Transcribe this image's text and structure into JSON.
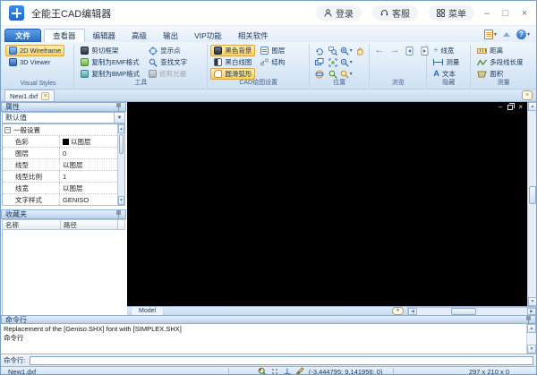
{
  "window": {
    "title": "全能王CAD编辑器",
    "minimize": "–",
    "maximize": "□",
    "close": "×"
  },
  "titlebar": {
    "login": "登录",
    "service": "客服",
    "menu": "菜单"
  },
  "tabs": [
    {
      "label": "文件"
    },
    {
      "label": "查看器"
    },
    {
      "label": "编辑器"
    },
    {
      "label": "高级"
    },
    {
      "label": "输出"
    },
    {
      "label": "VIP功能"
    },
    {
      "label": "相关软件"
    }
  ],
  "ribbon": {
    "visual_styles": {
      "label": "Visual Styles",
      "wireframe": "2D Wireframe",
      "viewer": "3D Viewer"
    },
    "tools": {
      "label": "工具",
      "cut_frame": "剪切框架",
      "copy_emf": "复制为EMF格式",
      "copy_bmp": "复制为BMP格式",
      "show_points": "显示点",
      "find_text": "查找文字",
      "trim_raster": "修剪光栅"
    },
    "cad_settings": {
      "label": "CAD绘图设置",
      "black_bg": "黑色背景",
      "layers": "图层",
      "bw_drawing": "黑白线图",
      "structure": "结构",
      "smooth_arc": "圆滑弧形"
    },
    "position": {
      "label": "位置"
    },
    "browse": {
      "label": "浏览"
    },
    "hide": {
      "label": "隐藏",
      "line_width": "线宽",
      "measure": "测量",
      "text": "文本"
    },
    "measure": {
      "label": "测量",
      "distance": "距离",
      "polyline_length": "多段线长度",
      "area": "面积"
    }
  },
  "document": {
    "tab": "New1.dxf",
    "model_tab": "Model"
  },
  "properties": {
    "title": "属性",
    "preset": "默认值",
    "group": "一般设置",
    "rows": [
      {
        "name": "色彩",
        "value": "以图层"
      },
      {
        "name": "图层",
        "value": "0"
      },
      {
        "name": "线型",
        "value": "以图层"
      },
      {
        "name": "线型比例",
        "value": "1"
      },
      {
        "name": "线宽",
        "value": "以图层"
      },
      {
        "name": "文字样式",
        "value": "GENISO"
      }
    ]
  },
  "favorites": {
    "title": "收藏夹",
    "col_name": "名称",
    "col_path": "路径"
  },
  "command": {
    "title": "命令行",
    "line1": "Replacement of the [Geniso.SHX] font with [SIMPLEX.SHX]",
    "line2": "命令行",
    "prompt": "命令行:",
    "input_value": ""
  },
  "statusbar": {
    "doc": "New1.dxf",
    "coords": "(-3.444795; 9.141956; 0)",
    "dims": "297 x 210 x 0"
  },
  "colors": {
    "highlight": "#fbd46b",
    "accent_blue": "#3d6fb4",
    "canvas_bg": "#000000"
  }
}
